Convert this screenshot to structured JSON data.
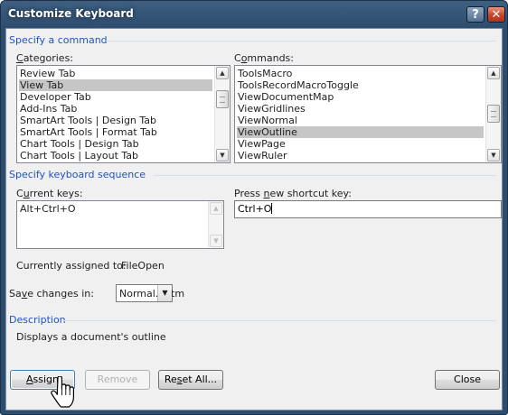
{
  "window": {
    "title": "Customize Keyboard"
  },
  "titlebar": {
    "help_glyph": "?",
    "close_glyph": "✕"
  },
  "sections": {
    "command": "Specify a command",
    "keyboard": "Specify keyboard sequence",
    "description": "Description"
  },
  "categories": {
    "label": "Categories:",
    "items": [
      "Review Tab",
      "View Tab",
      "Developer Tab",
      "Add-Ins Tab",
      "SmartArt Tools | Design Tab",
      "SmartArt Tools | Format Tab",
      "Chart Tools | Design Tab",
      "Chart Tools | Layout Tab"
    ],
    "selected": "View Tab"
  },
  "commands": {
    "label": "Commands:",
    "items": [
      "ToolsMacro",
      "ToolsRecordMacroToggle",
      "ViewDocumentMap",
      "ViewGridlines",
      "ViewNormal",
      "ViewOutline",
      "ViewPage",
      "ViewRuler"
    ],
    "selected": "ViewOutline"
  },
  "current_keys": {
    "label": "Current keys:",
    "items": [
      "Alt+Ctrl+O"
    ]
  },
  "new_shortcut": {
    "label": "Press new shortcut key:",
    "value": "Ctrl+O"
  },
  "assigned": {
    "label": "Currently assigned to:",
    "value": "FileOpen"
  },
  "save_changes": {
    "label": "Save changes in:",
    "value": "Normal.dotm"
  },
  "description_text": "Displays a document's outline",
  "buttons": {
    "assign": "Assign",
    "remove": "Remove",
    "reset_all": "Reset All...",
    "close": "Close"
  },
  "colors": {
    "section_title": "#1f54c0",
    "selection": "#c6c6c6",
    "titlebar": "#2d4d6e",
    "close_button": "#c8432a"
  }
}
